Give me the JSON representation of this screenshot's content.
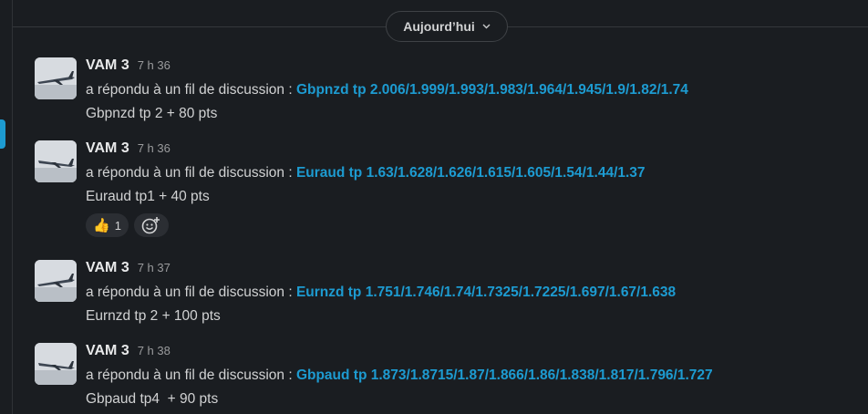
{
  "day_divider": {
    "label": "Aujourd’hui",
    "chevron": "chevron-down-icon"
  },
  "messages": [
    {
      "author": "VAM 3",
      "time": "7 h 36",
      "reply_prefix": "a répondu à un fil de discussion : ",
      "thread_title": "Gbpnzd tp 2.006/1.999/1.993/1.983/1.964/1.945/1.9/1.82/1.74",
      "text": "Gbpnzd tp 2 + 80 pts"
    },
    {
      "author": "VAM 3",
      "time": "7 h 36",
      "reply_prefix": "a répondu à un fil de discussion : ",
      "thread_title": "Euraud tp 1.63/1.628/1.626/1.615/1.605/1.54/1.44/1.37",
      "text": "Euraud tp1 + 40 pts",
      "reaction": {
        "emoji": "👍",
        "count": "1"
      }
    },
    {
      "author": "VAM 3",
      "time": "7 h 37",
      "reply_prefix": "a répondu à un fil de discussion : ",
      "thread_title": "Eurnzd tp 1.751/1.746/1.74/1.7325/1.7225/1.697/1.67/1.638",
      "text": "Eurnzd tp 2 + 100 pts"
    },
    {
      "author": "VAM 3",
      "time": "7 h 38",
      "reply_prefix": "a répondu à un fil de discussion : ",
      "thread_title": "Gbpaud tp 1.873/1.8715/1.87/1.866/1.86/1.838/1.817/1.796/1.727",
      "text": "Gbpaud tp4  + 90 pts"
    }
  ],
  "colors": {
    "background": "#1a1d21",
    "link": "#1d9bd1",
    "text": "#d1d2d3",
    "muted": "#9a9b9d"
  }
}
